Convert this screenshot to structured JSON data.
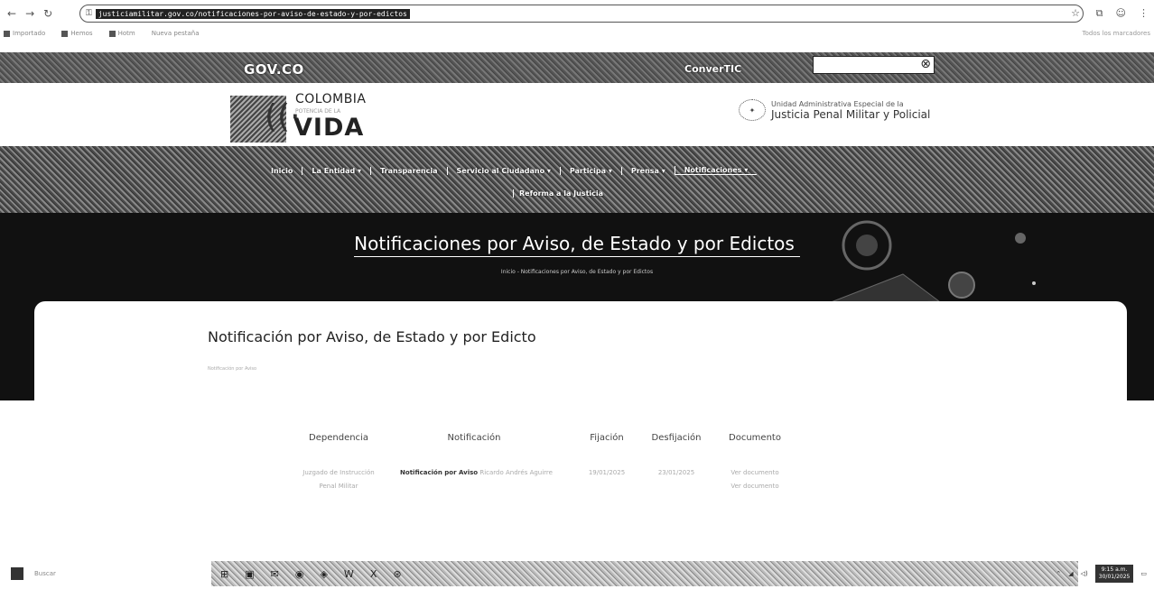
{
  "browser": {
    "url": "justiciamilitar.gov.co/notificaciones-por-aviso-de-estado-y-por-edictos",
    "bookmarks": [
      "Importado",
      "Hemos",
      "Hotm",
      "Nueva pestaña"
    ],
    "bookmarks_right": "Todos los marcadores"
  },
  "govbar": {
    "logo": "GOV.CO",
    "convertic": "ConverTIC"
  },
  "header": {
    "colombia": "COLOMBIA",
    "colombia_small": "POTENCIA DE LA",
    "vida": "VIDA",
    "entity_line1": "Unidad Administrativa Especial de la",
    "entity_line2": "Justicia Penal Militar y Policial"
  },
  "nav": {
    "items": [
      {
        "label": "Inicio"
      },
      {
        "label": "La Entidad ▾"
      },
      {
        "label": "Transparencia"
      },
      {
        "label": "Servicio al Ciudadano ▾"
      },
      {
        "label": "Participa ▾"
      },
      {
        "label": "Prensa ▾"
      },
      {
        "label": "Notificaciones ▾"
      }
    ],
    "row2": "Reforma a la Justicia"
  },
  "hero": {
    "title": "Notificaciones por Aviso, de Estado y por Edictos",
    "breadcrumb": "Inicio - Notificaciones por Aviso, de Estado y por Edictos"
  },
  "card": {
    "title": "Notificación por Aviso, de Estado y por Edicto",
    "subtitle": "Notificación por Aviso"
  },
  "table": {
    "headers": [
      "Dependencia",
      "Notificación",
      "Fijación",
      "Desfijación",
      "Documento"
    ],
    "row": {
      "dependencia": "Juzgado de Instrucción Penal Militar",
      "notificacion_bold": "Notificación por Aviso",
      "notificacion_rest": "Ricardo Andrés Aguirre",
      "fijacion": "19/01/2025",
      "desfijacion": "23/01/2025",
      "documento": [
        "Ver documento",
        "Ver documento"
      ]
    }
  },
  "taskbar": {
    "search": "Buscar",
    "time": "9:15 a.m.",
    "date": "30/01/2025"
  }
}
